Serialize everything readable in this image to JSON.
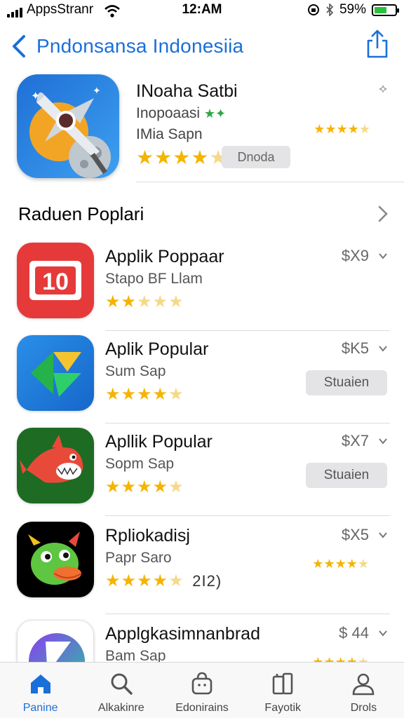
{
  "status_bar": {
    "carrier": "AppsStranr",
    "time": "12:AM",
    "battery_percent": "59%",
    "battery_level": 0.59
  },
  "nav": {
    "title": "Pndonsansa Indonesiia"
  },
  "featured": {
    "name": "INoaha Satbi",
    "subtitle": "Inopoaasi",
    "developer": "IMia Sapn",
    "rating": 3.5,
    "small_rating": 3.5,
    "button": "Dnoda"
  },
  "section": {
    "title": "Raduen Poplari"
  },
  "apps": [
    {
      "name": "Applik Poppaar",
      "subtitle": "Stapo BF Llam",
      "price": "$X9",
      "rating": 1.5,
      "icon": "ten-icon",
      "icon_text": "10"
    },
    {
      "name": "Aplik Popular",
      "subtitle": "Sum Sap",
      "price": "$K5",
      "rating": 4,
      "button": "Stuaien",
      "icon": "g-icon"
    },
    {
      "name": "Apllik Popular",
      "subtitle": "Sopm Sap",
      "price": "$X7",
      "rating": 3.5,
      "button": "Stuaien",
      "icon": "shark-icon"
    },
    {
      "name": "Rpliokadisj",
      "subtitle": "Papr Saro",
      "price": "$X5",
      "rating": 4,
      "rating_extra": "2I2)",
      "small_rating": 4,
      "icon": "dragon-icon"
    },
    {
      "name": "Applgkasimnanbrad",
      "subtitle": "Bam Sap",
      "price": "$ 44",
      "small_rating": 3.5,
      "icon": "k-icon"
    }
  ],
  "tabs": [
    {
      "label": "Panine",
      "icon": "home-icon",
      "active": true
    },
    {
      "label": "Alkakinre",
      "icon": "search-icon",
      "active": false
    },
    {
      "label": "Edonirains",
      "icon": "bag-icon",
      "active": false
    },
    {
      "label": "Fayotik",
      "icon": "devices-icon",
      "active": false
    },
    {
      "label": "Drols",
      "icon": "person-icon",
      "active": false
    }
  ],
  "colors": {
    "accent": "#1a6fd8",
    "star": "#f5b400",
    "battery": "#2dbe3c"
  }
}
